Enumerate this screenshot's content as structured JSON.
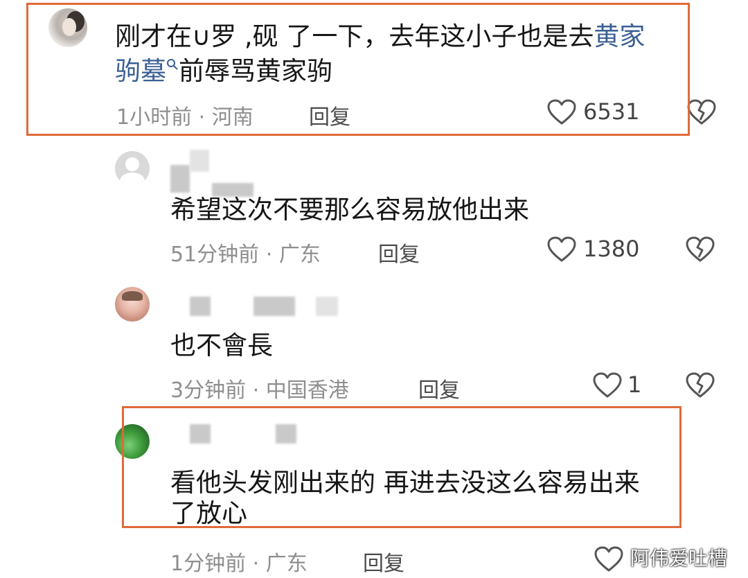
{
  "comments": [
    {
      "text_lines": [
        "刚才在∪罗 ,砚 了一下，去年这小子也是去",
        "前辱骂黄家驹"
      ],
      "link_a": "黄家",
      "link_b": "驹墓",
      "time": "1小时前",
      "location": "河南",
      "reply_label": "回复",
      "likes": "6531"
    },
    {
      "text": "希望这次不要那么容易放他出来",
      "time": "51分钟前",
      "location": "广东",
      "reply_label": "回复",
      "likes": "1380"
    },
    {
      "text": "也不會長",
      "time": "3分钟前",
      "location": "中国香港",
      "reply_label": "回复",
      "likes": "1"
    },
    {
      "text_lines": [
        "看他头发刚出来的 再进去没这么容易出来",
        "了放心"
      ],
      "time": "1分钟前",
      "location": "广东",
      "reply_label": "回复"
    }
  ],
  "separator": "·",
  "watermark": "阿伟爱吐槽",
  "colors": {
    "highlight_box": "#e06a3a",
    "link": "#3a5f93",
    "meta_gray": "#8e8e8e"
  },
  "icons": [
    "heart-icon",
    "broken-heart-icon",
    "search-icon"
  ]
}
